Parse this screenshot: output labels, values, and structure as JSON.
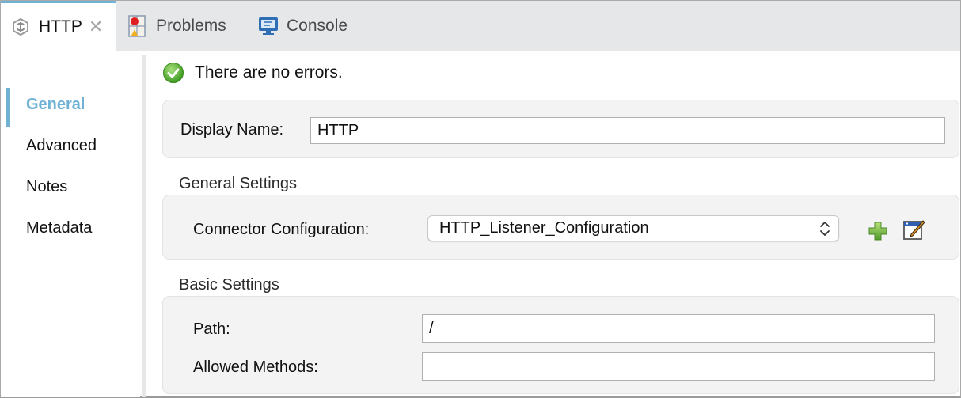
{
  "tabs": [
    {
      "label": "HTTP",
      "icon": "http-connector-icon",
      "active": true,
      "closable": true
    },
    {
      "label": "Problems",
      "icon": "problems-icon",
      "active": false
    },
    {
      "label": "Console",
      "icon": "console-icon",
      "active": false
    }
  ],
  "sidebar": {
    "items": [
      {
        "label": "General",
        "active": true
      },
      {
        "label": "Advanced",
        "active": false
      },
      {
        "label": "Notes",
        "active": false
      },
      {
        "label": "Metadata",
        "active": false
      }
    ]
  },
  "status": {
    "text": "There are no errors.",
    "icon": "check-circle-icon"
  },
  "display_name": {
    "label": "Display Name:",
    "value": "HTTP"
  },
  "general_settings": {
    "title": "General Settings",
    "connector_label": "Connector Configuration:",
    "connector_value": "HTTP_Listener_Configuration",
    "add_icon": "plus-icon",
    "edit_icon": "edit-icon"
  },
  "basic_settings": {
    "title": "Basic Settings",
    "path_label": "Path:",
    "path_value": "/",
    "methods_label": "Allowed Methods:",
    "methods_value": ""
  },
  "colors": {
    "accent": "#6fb2d6",
    "tabbar_bg": "#e6e7e9",
    "panel_bg": "#f3f3f3",
    "success": "#5cb531",
    "add_green": "#7cc142"
  }
}
